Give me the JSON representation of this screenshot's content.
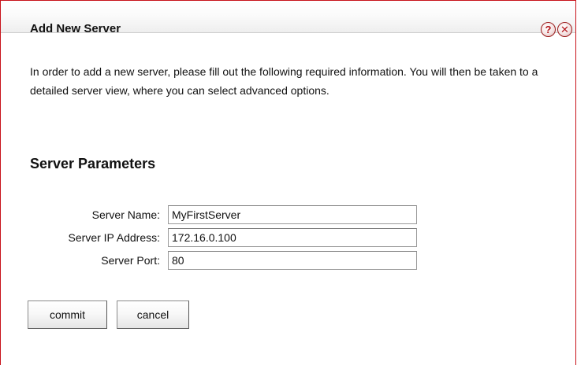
{
  "dialog": {
    "title": "Add New Server",
    "help_icon": "question-mark",
    "close_icon": "x-mark",
    "intro_text": "In order to add a new server, please fill out the following required information. You will then be taken to a detailed server view, where you can select advanced options."
  },
  "section": {
    "title": "Server Parameters"
  },
  "form": {
    "server_name": {
      "label": "Server Name:",
      "value": "MyFirstServer"
    },
    "server_ip": {
      "label": "Server IP Address:",
      "value": "172.16.0.100"
    },
    "server_port": {
      "label": "Server Port:",
      "value": "80"
    }
  },
  "buttons": {
    "commit": "commit",
    "cancel": "cancel"
  },
  "colors": {
    "border_accent": "#c8121a",
    "icon_accent": "#b3161b"
  }
}
